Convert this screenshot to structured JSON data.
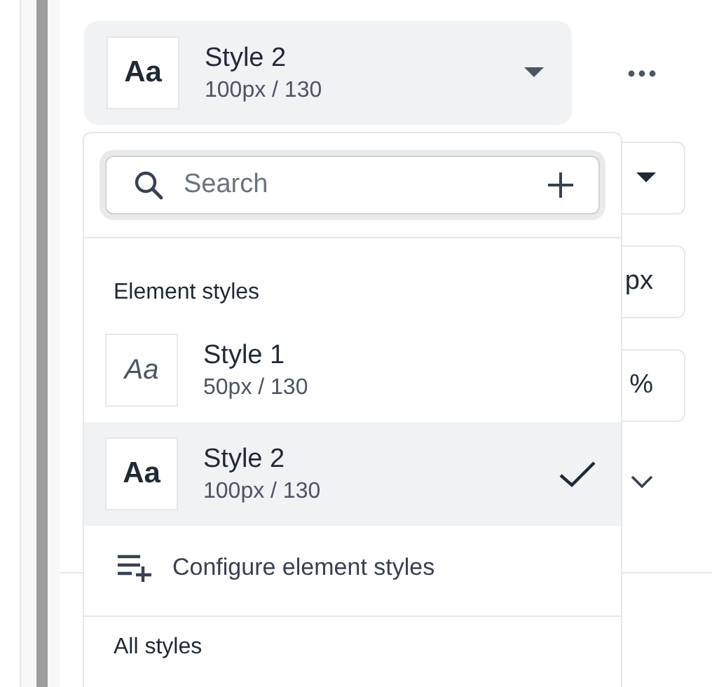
{
  "selector": {
    "preview_text": "Aa",
    "kind": "bold",
    "title": "Style 2",
    "subtitle": "100px / 130"
  },
  "background_fields": [
    {
      "kind": "select"
    },
    {
      "kind": "unit",
      "text": "px"
    },
    {
      "kind": "unit",
      "text": "%"
    },
    {
      "kind": "chevron"
    }
  ],
  "dropdown": {
    "search": {
      "placeholder": "Search"
    },
    "section_title": "Element styles",
    "items": [
      {
        "preview_text": "Aa",
        "kind": "light",
        "title": "Style 1",
        "subtitle": "50px / 130",
        "selected": false
      },
      {
        "preview_text": "Aa",
        "kind": "bold",
        "title": "Style 2",
        "subtitle": "100px / 130",
        "selected": true
      }
    ],
    "action": "Configure element styles",
    "next_section": "All styles"
  }
}
